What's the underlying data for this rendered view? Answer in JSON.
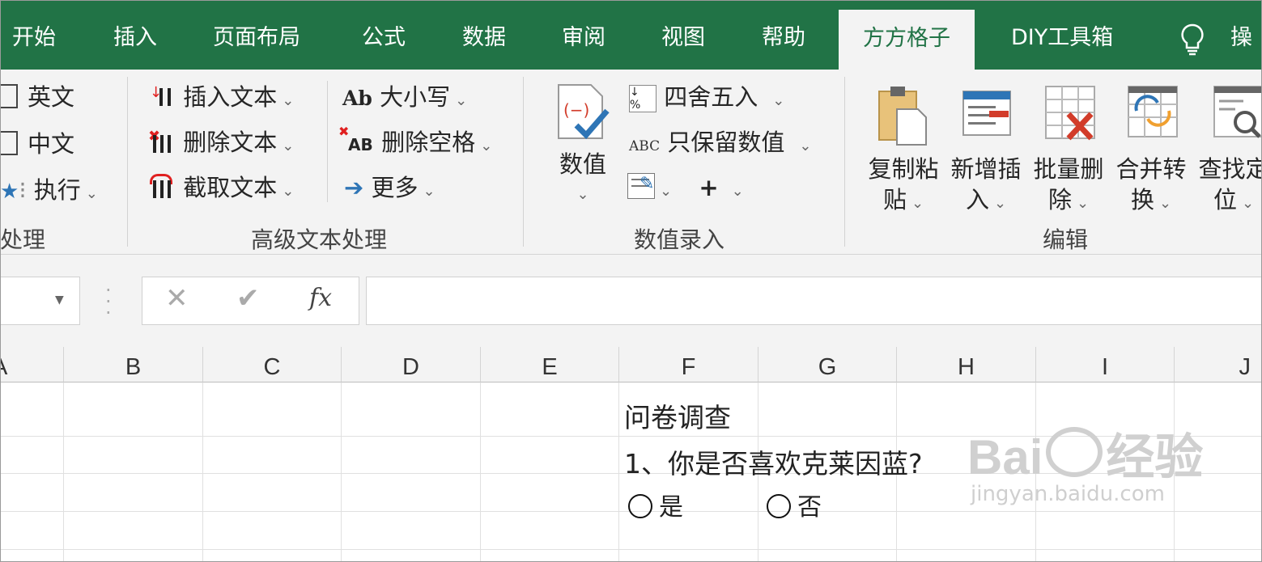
{
  "tabs": [
    {
      "label": "开始",
      "active": false
    },
    {
      "label": "插入",
      "active": false
    },
    {
      "label": "页面布局",
      "active": false
    },
    {
      "label": "公式",
      "active": false
    },
    {
      "label": "数据",
      "active": false
    },
    {
      "label": "审阅",
      "active": false
    },
    {
      "label": "视图",
      "active": false
    },
    {
      "label": "帮助",
      "active": false
    },
    {
      "label": "方方格子",
      "active": true
    },
    {
      "label": "DIY工具箱",
      "active": false
    },
    {
      "label": "操",
      "active": false
    }
  ],
  "ribbon": {
    "group1": {
      "items": [
        "英文",
        "中文",
        "执行"
      ],
      "label": "处理"
    },
    "group2": {
      "items": [
        "插入文本",
        "删除文本",
        "截取文本",
        "大小写",
        "删除空格",
        "更多"
      ],
      "ab_glyph": "Ab",
      "abx_glyph": "AB",
      "label": "高级文本处理"
    },
    "group3": {
      "big_button": "数值",
      "items": [
        "四舍五入",
        "只保留数值"
      ],
      "abc_glyph": "ABC",
      "label": "数值录入"
    },
    "group4": {
      "buttons": [
        {
          "line1": "复制粘",
          "line2": "贴"
        },
        {
          "line1": "新增插",
          "line2": "入"
        },
        {
          "line1": "批量删",
          "line2": "除"
        },
        {
          "line1": "合并转",
          "line2": "换"
        },
        {
          "line1": "查找定",
          "line2": "位"
        }
      ],
      "label": "编辑"
    }
  },
  "formula_bar": {
    "fx": "fx",
    "value": ""
  },
  "columns": [
    "A",
    "B",
    "C",
    "D",
    "E",
    "F",
    "G",
    "H",
    "I",
    "J"
  ],
  "cells": {
    "title": "问卷调查",
    "question": "1、你是否喜欢克莱因蓝?",
    "option_yes": "是",
    "option_no": "否"
  },
  "watermark": {
    "brand": "Bai",
    "du": "du",
    "suffix": "经验",
    "url": "jingyan.baidu.com"
  },
  "colors": {
    "excel_green": "#217346",
    "ribbon_bg": "#f3f3f3",
    "grid_line": "#e0e0e0"
  }
}
